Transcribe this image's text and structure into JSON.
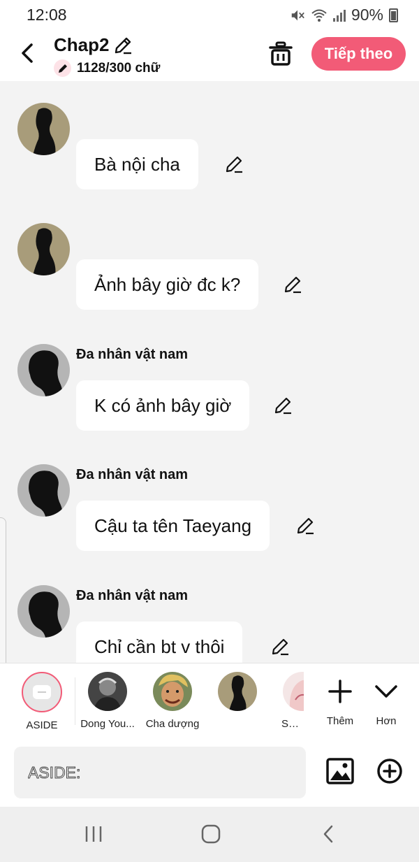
{
  "status_bar": {
    "time": "12:08",
    "battery": "90%"
  },
  "header": {
    "title": "Chap2",
    "word_count": "1128/300 chữ",
    "next_label": "Tiếp theo"
  },
  "messages": [
    {
      "sender": "",
      "text": "Bà nội cha",
      "avatar": "tan-silhouette"
    },
    {
      "sender": "",
      "text": "Ảnh bây giờ đc k?",
      "avatar": "tan-silhouette"
    },
    {
      "sender": "Đa nhân vật nam",
      "text": "K có ảnh bây giờ",
      "avatar": "gray-silhouette"
    },
    {
      "sender": "Đa nhân vật nam",
      "text": "Cậu ta tên Taeyang",
      "avatar": "gray-silhouette"
    },
    {
      "sender": "Đa nhân vật nam",
      "text": "Chỉ cần bt v thôi",
      "avatar": "gray-silhouette"
    }
  ],
  "characters": [
    {
      "label": "ASIDE"
    },
    {
      "label": "Dong You..."
    },
    {
      "label": "Cha dượng"
    },
    {
      "label": ""
    },
    {
      "label": "Seo..."
    }
  ],
  "actions": {
    "add_label": "Thêm",
    "more_label": "Hơn"
  },
  "composer": {
    "placeholder": "ASIDE:"
  },
  "colors": {
    "accent": "#f25b77",
    "bubble": "#ffffff",
    "background": "#f3f3f3"
  }
}
